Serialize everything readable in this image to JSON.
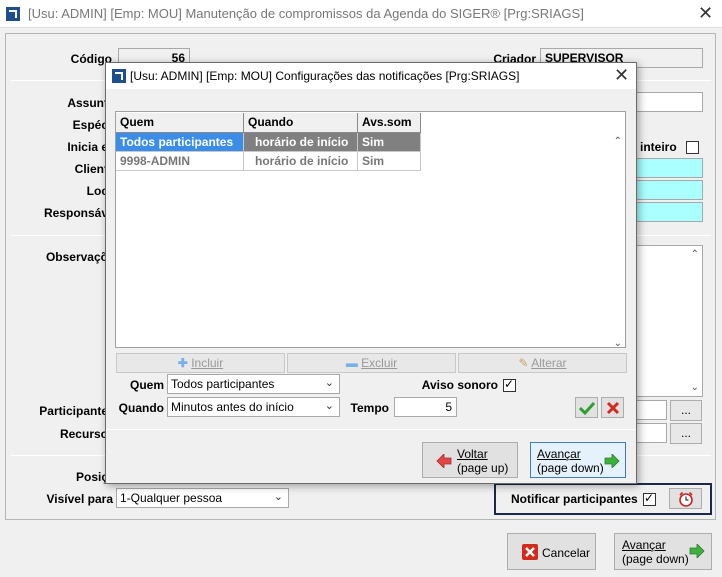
{
  "window": {
    "title": "[Usu: ADMIN] [Emp: MOU] Manutenção de compromissos da Agenda do SIGER® [Prg:SRIAGS]"
  },
  "main": {
    "codigo_label": "Código",
    "codigo_value": "56",
    "criador_label": "Criador",
    "criador_value": "SUPERVISOR",
    "assunto_label": "Assunt",
    "especie_label": "Espéc",
    "inicia_label": "Inicia e",
    "dia_inteiro_label": "a inteiro",
    "cliente_label": "Client",
    "local_label": "Loc",
    "responsavel_label": "Responsáv",
    "observacoes_label": "Observaçõ",
    "participantes_label": "Participante",
    "recursos_label": "Recurso",
    "ellipsis": "...",
    "posicao_label": "Posiç",
    "visivel_label": "Visível para",
    "visivel_value": "1-Qualquer pessoa",
    "notificar_label": "Notificar participantes",
    "cancelar_label": "Cancelar",
    "avancar_line1": "Avançar",
    "avancar_line2": "(page down)"
  },
  "dialog": {
    "title": "[Usu: ADMIN] [Emp: MOU] Configurações das notificações [Prg:SRIAGS]",
    "columns": [
      "Quem",
      "Quando",
      "Avs.som"
    ],
    "rows": [
      {
        "quem": "Todos participantes",
        "quando": "horário de início",
        "avs": "Sim"
      },
      {
        "quem": "9998-ADMIN",
        "quando": "horário de início",
        "avs": "Sim"
      }
    ],
    "incluir": "Incluir",
    "excluir": "Excluir",
    "alterar": "Alterar",
    "quem_label": "Quem",
    "quem_value": "Todos participantes",
    "aviso_label": "Aviso sonoro",
    "quando_label": "Quando",
    "quando_value": "Minutos antes do início",
    "tempo_label": "Tempo",
    "tempo_value": "5",
    "voltar_line1": "Voltar",
    "voltar_line2": "(page up)",
    "avancar_line1": "Avançar",
    "avancar_line2": "(page down)"
  },
  "colors": {
    "selection": "#3b8de8",
    "cyan_field": "#aaffff",
    "ok_green": "#2e9e2e",
    "cancel_red": "#d42a1e"
  }
}
